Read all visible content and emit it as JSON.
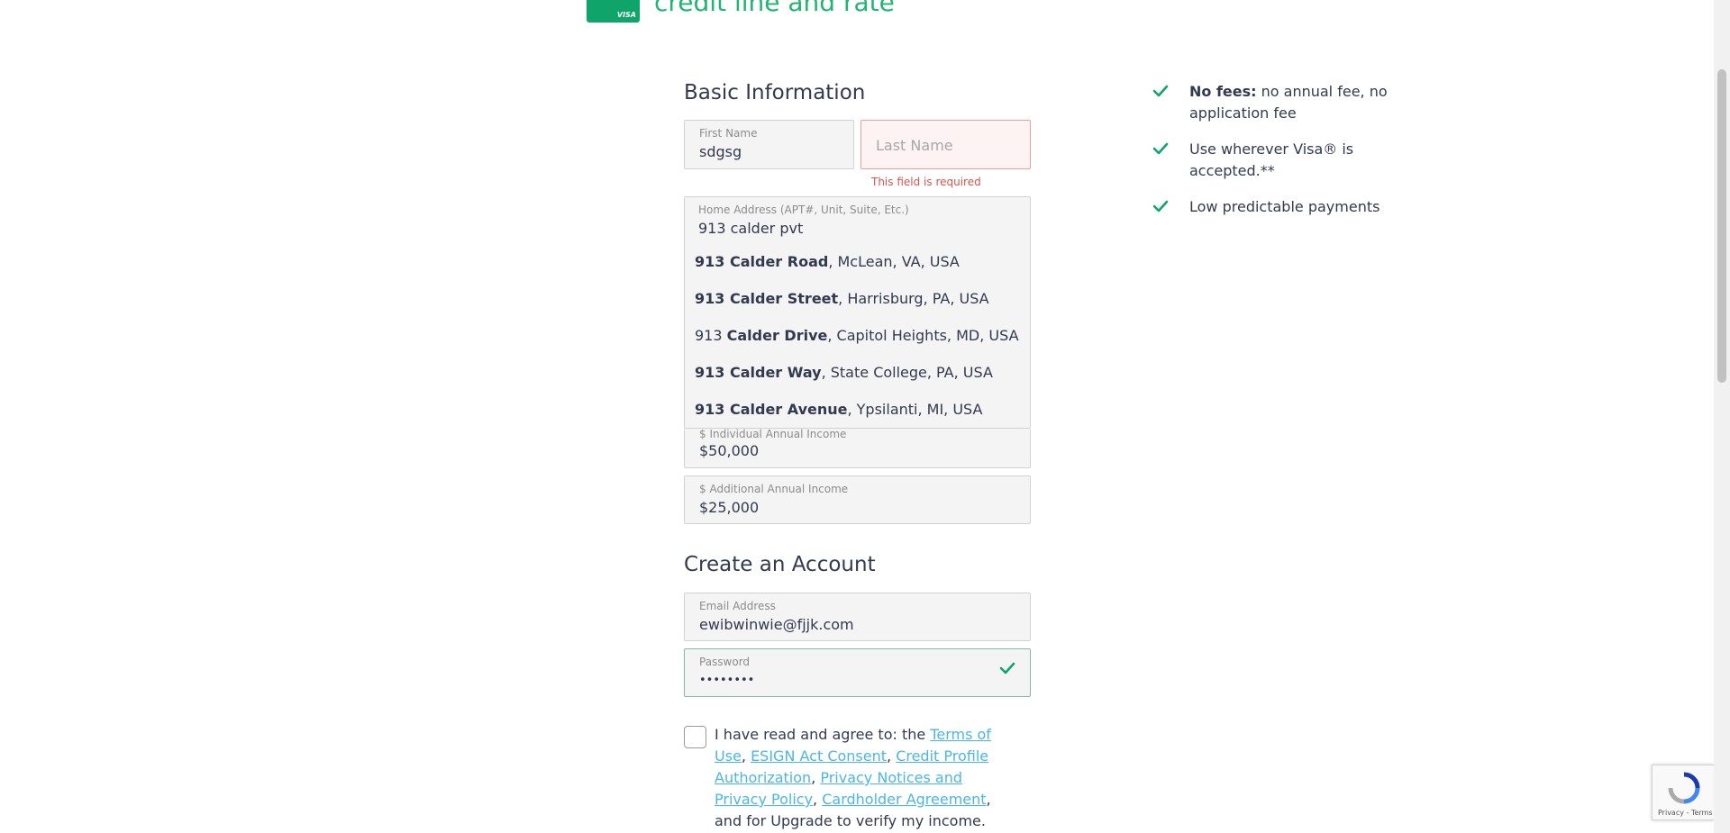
{
  "header": {
    "card_brand": "VISA",
    "title": "credit line and rate"
  },
  "basic_info": {
    "title": "Basic Information",
    "first_name": {
      "label": "First Name",
      "value": "sdgsg"
    },
    "last_name": {
      "placeholder": "Last Name",
      "error": "This field is required"
    },
    "address": {
      "label": "Home Address (APT#, Unit, Suite, Etc.)",
      "value": "913 calder pvt",
      "suggestions": [
        {
          "bold": "913 Calder Road",
          "rest": ", McLean, VA, USA"
        },
        {
          "bold": "913 Calder Street",
          "rest": ", Harrisburg, PA, USA"
        },
        {
          "plain": "913 ",
          "bold": "Calder Drive",
          "rest": ", Capitol Heights, MD, USA"
        },
        {
          "bold": "913 Calder Way",
          "rest": ", State College, PA, USA"
        },
        {
          "bold": "913 Calder Avenue",
          "rest": ", Ypsilanti, MI, USA"
        }
      ]
    },
    "individual_income": {
      "label": "$ Individual Annual Income",
      "value": "$50,000"
    },
    "additional_income": {
      "label": "$ Additional Annual Income",
      "value": "$25,000"
    }
  },
  "account": {
    "title": "Create an Account",
    "email": {
      "label": "Email Address",
      "value": "ewibwinwie@fjjk.com"
    },
    "password": {
      "label": "Password",
      "value": "••••••••"
    }
  },
  "terms": {
    "prefix": "I have read and agree to: the ",
    "links": [
      "Terms of Use",
      "ESIGN Act Consent",
      "Credit Profile Authorization",
      "Privacy Notices and Privacy Policy",
      "Cardholder Agreement"
    ],
    "separator": ", ",
    "suffix": ", and for Upgrade to verify my income."
  },
  "benefits": [
    {
      "bold": "No fees:",
      "text": " no annual fee, no application fee"
    },
    {
      "bold": "",
      "text": "Use wherever Visa® is accepted.**"
    },
    {
      "bold": "",
      "text": "Low predictable payments"
    }
  ],
  "recaptcha": {
    "text": "Privacy - Terms"
  },
  "colors": {
    "brand_green": "#21b573",
    "link_blue": "#4ab7e6",
    "error_red": "#d9534f",
    "check_green": "#0fa46a"
  }
}
